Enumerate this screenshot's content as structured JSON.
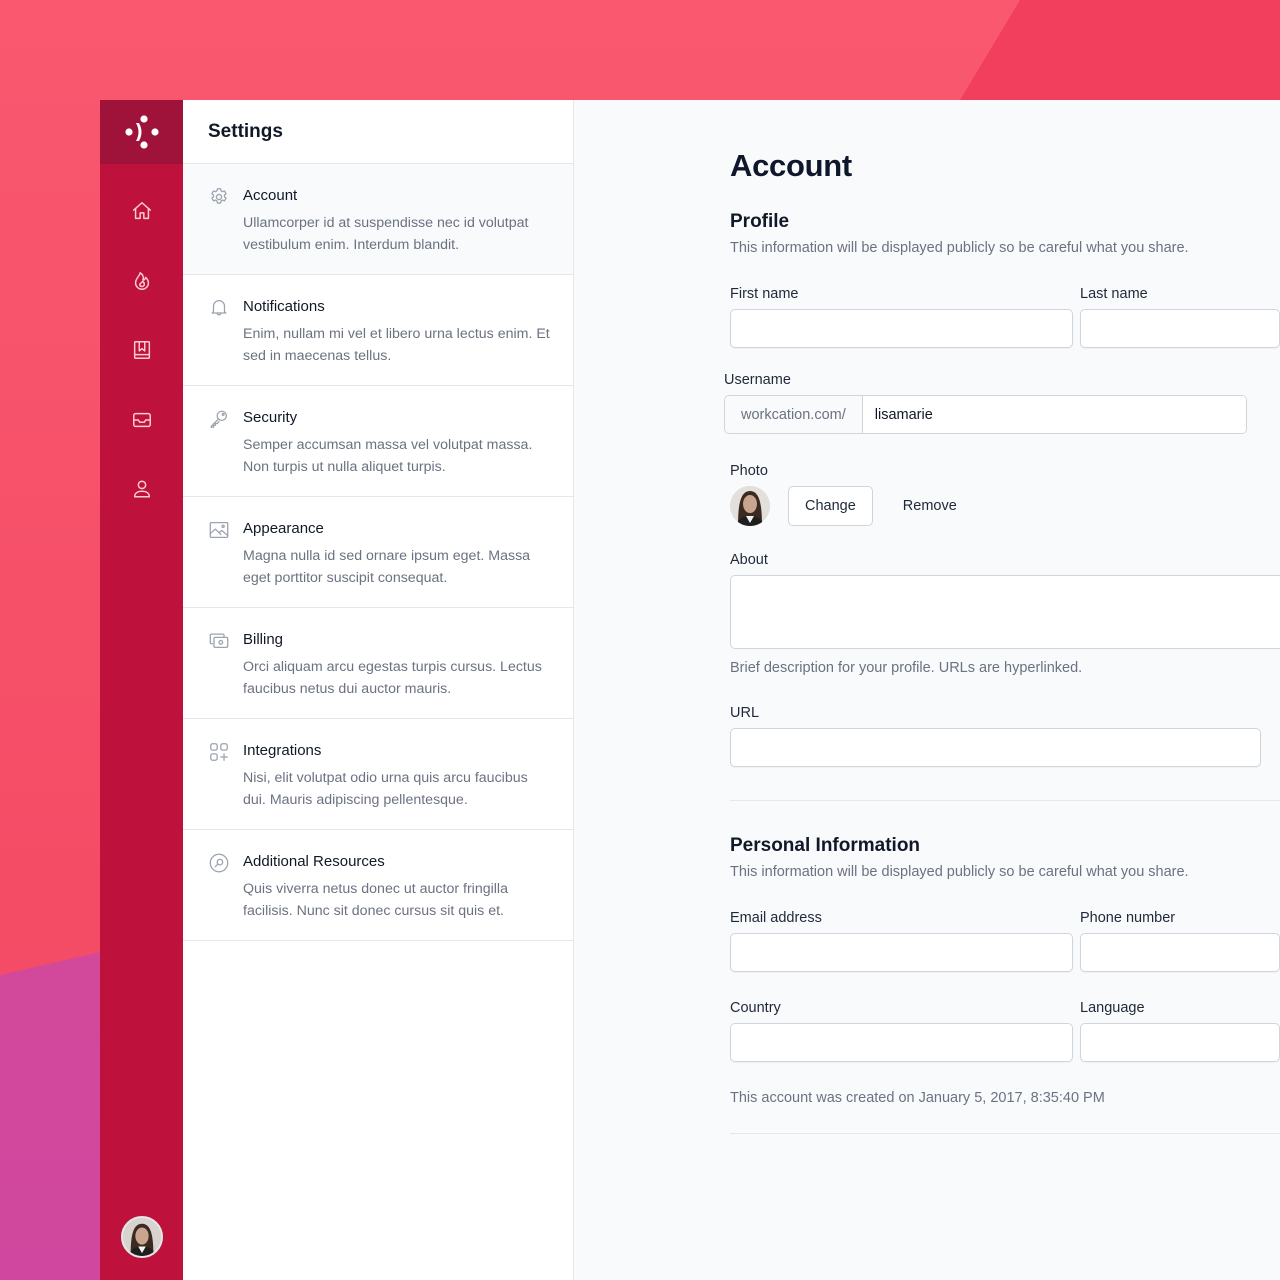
{
  "colors": {
    "accent": "#be123c",
    "accent_dark": "#9f1239",
    "background": "#f8566f"
  },
  "rail": {
    "logo": "brand-logo",
    "items": [
      {
        "name": "home",
        "icon": "home-icon"
      },
      {
        "name": "trending",
        "icon": "fire-icon"
      },
      {
        "name": "bookmarks",
        "icon": "bookmark-icon"
      },
      {
        "name": "inbox",
        "icon": "inbox-icon"
      },
      {
        "name": "profile",
        "icon": "user-icon"
      }
    ],
    "avatar": "user-avatar"
  },
  "settings": {
    "title": "Settings",
    "items": [
      {
        "title": "Account",
        "desc": "Ullamcorper id at suspendisse nec id volutpat vestibulum enim. Interdum blandit.",
        "icon": "gear-icon",
        "active": true
      },
      {
        "title": "Notifications",
        "desc": "Enim, nullam mi vel et libero urna lectus enim. Et sed in maecenas tellus.",
        "icon": "bell-icon"
      },
      {
        "title": "Security",
        "desc": "Semper accumsan massa vel volutpat massa. Non turpis ut nulla aliquet turpis.",
        "icon": "key-icon"
      },
      {
        "title": "Appearance",
        "desc": "Magna nulla id sed ornare ipsum eget. Massa eget porttitor suscipit consequat.",
        "icon": "image-icon"
      },
      {
        "title": "Billing",
        "desc": "Orci aliquam arcu egestas turpis cursus. Lectus faucibus netus dui auctor mauris.",
        "icon": "cash-icon"
      },
      {
        "title": "Integrations",
        "desc": "Nisi, elit volutpat odio urna quis arcu faucibus dui. Mauris adipiscing pellentesque.",
        "icon": "apps-add-icon"
      },
      {
        "title": "Additional Resources",
        "desc": "Quis viverra netus donec ut auctor fringilla facilisis. Nunc sit donec cursus sit quis et.",
        "icon": "search-circle-icon"
      }
    ]
  },
  "main": {
    "title": "Account",
    "profile": {
      "title": "Profile",
      "subtitle": "This information will be displayed publicly so be careful what you share.",
      "first_name_label": "First name",
      "first_name_value": "",
      "last_name_label": "Last name",
      "last_name_value": "",
      "username_label": "Username",
      "username_prefix": "workcation.com/",
      "username_value": "lisamarie",
      "photo_label": "Photo",
      "change_label": "Change",
      "remove_label": "Remove",
      "about_label": "About",
      "about_value": "",
      "about_help": "Brief description for your profile. URLs are hyperlinked.",
      "url_label": "URL",
      "url_value": ""
    },
    "personal": {
      "title": "Personal Information",
      "subtitle": "This information will be displayed publicly so be careful what you share.",
      "email_label": "Email address",
      "email_value": "",
      "phone_label": "Phone number",
      "phone_value": "",
      "country_label": "Country",
      "country_value": "",
      "language_label": "Language",
      "language_value": "",
      "created_text": "This account was created on January 5, 2017, 8:35:40 PM"
    }
  }
}
